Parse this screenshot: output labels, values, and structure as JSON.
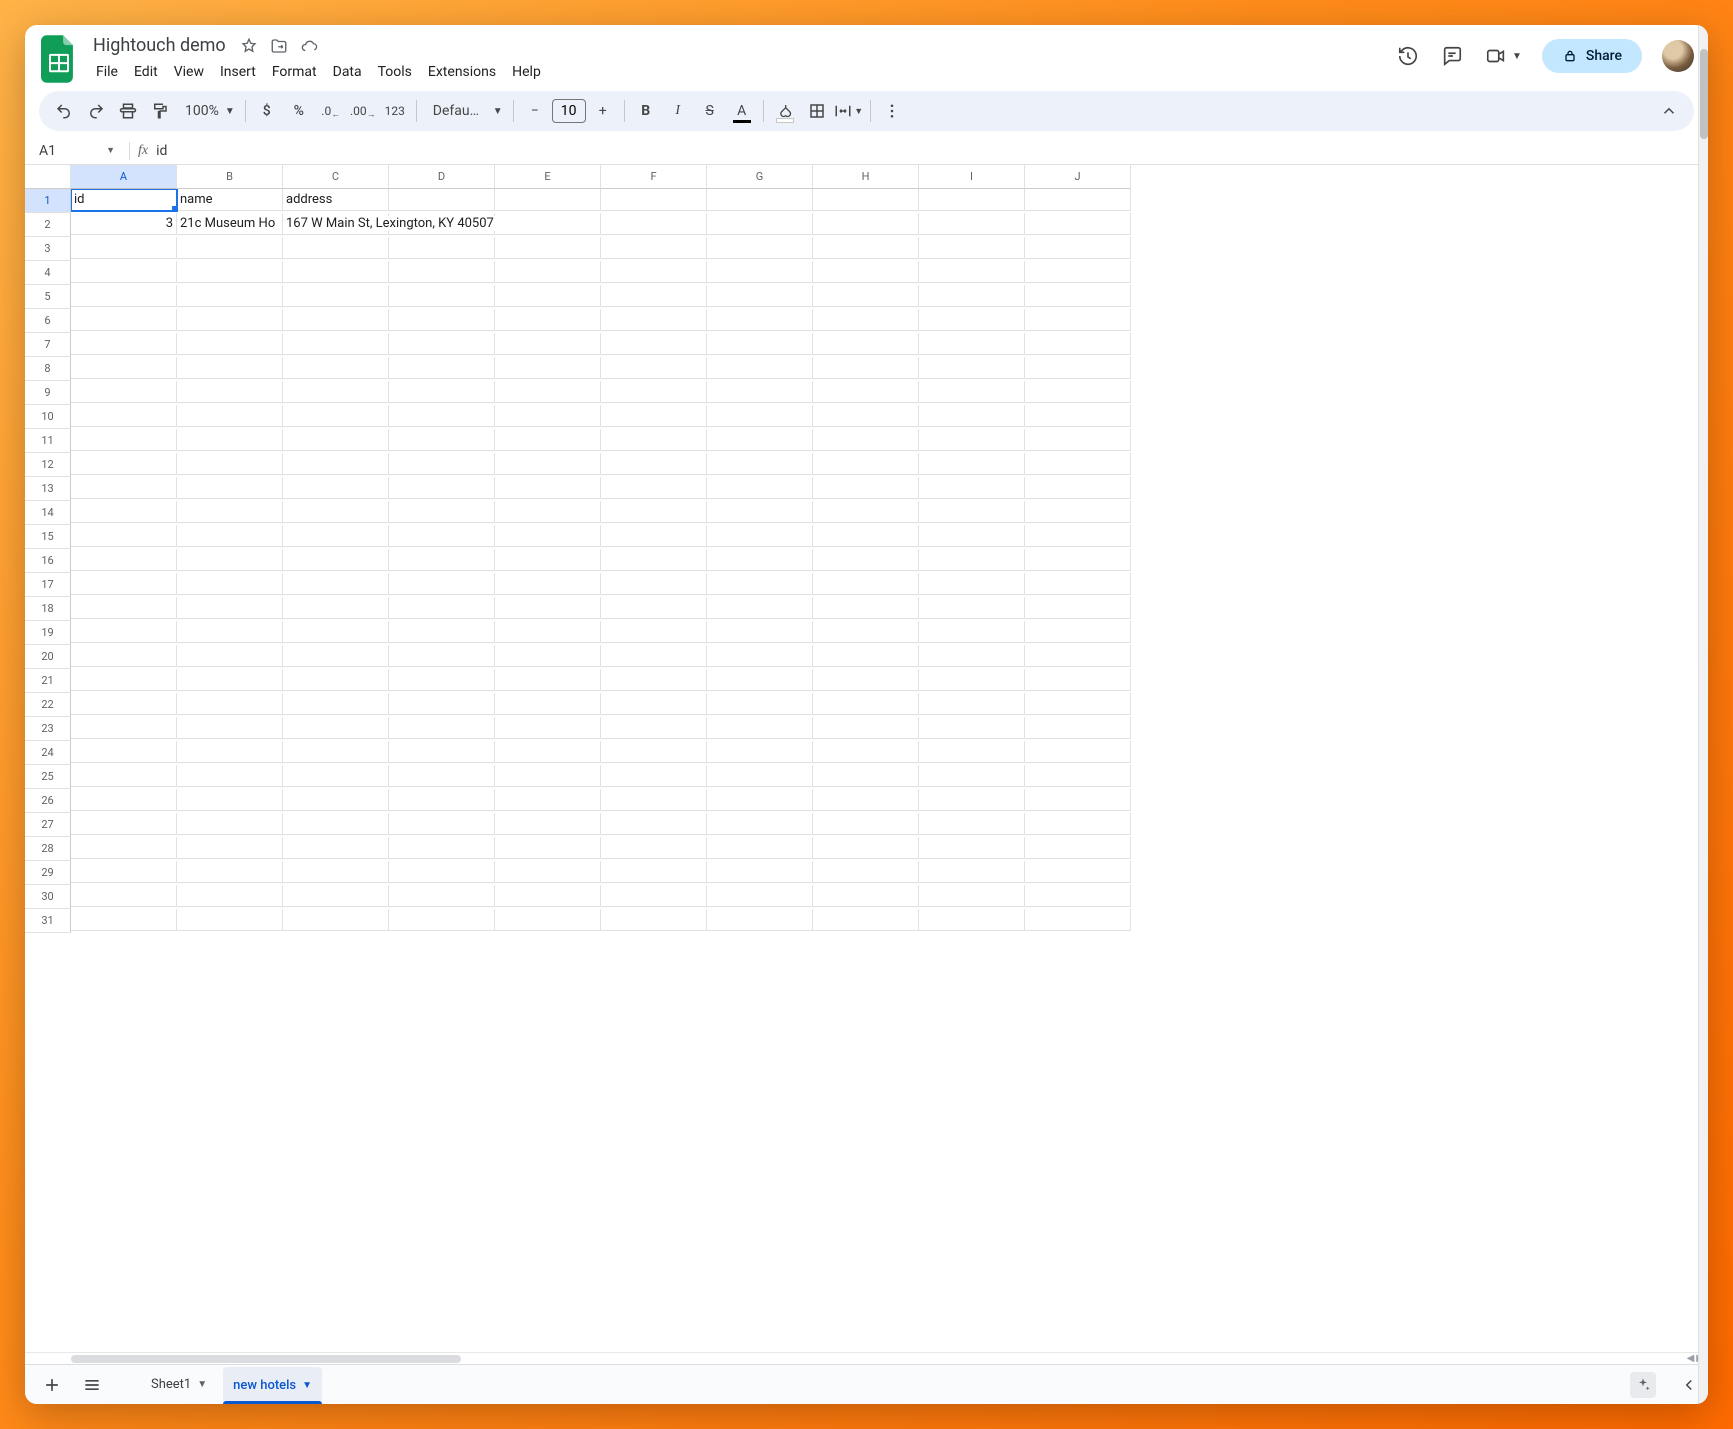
{
  "doc_title": "Hightouch demo",
  "menus": [
    "File",
    "Edit",
    "View",
    "Insert",
    "Format",
    "Data",
    "Tools",
    "Extensions",
    "Help"
  ],
  "share_label": "Share",
  "zoom_label": "100%",
  "font_label": "Defaul…",
  "font_size": "10",
  "name_box": "A1",
  "formula": "id",
  "columns": [
    "A",
    "B",
    "C",
    "D",
    "E",
    "F",
    "G",
    "H",
    "I",
    "J"
  ],
  "row_count": 31,
  "selected_cell": "A1",
  "cells": {
    "A1": "id",
    "B1": "name",
    "C1": "address",
    "A2": "3",
    "B2": "21c Museum Ho",
    "C2": "167 W Main St, Lexington, KY 40507"
  },
  "tabs": [
    {
      "label": "Sheet1",
      "active": false
    },
    {
      "label": "new hotels",
      "active": true
    }
  ]
}
